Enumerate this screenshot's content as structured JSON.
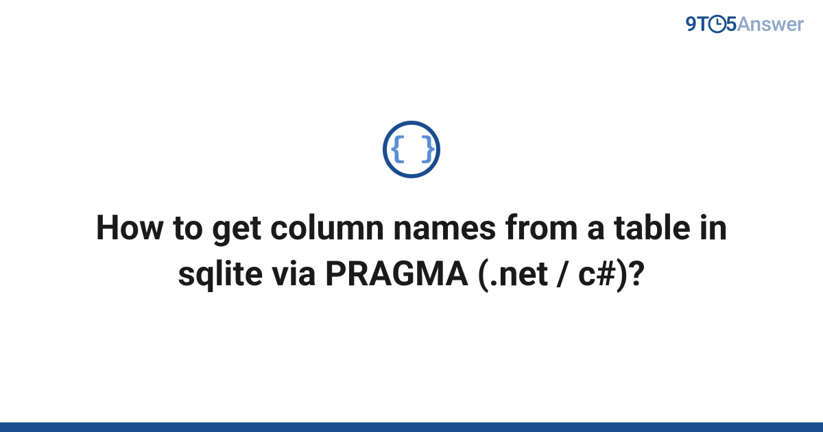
{
  "logo": {
    "part1": "9T",
    "part2": "5",
    "part3": "Answer"
  },
  "badge": {
    "symbol": "{ }"
  },
  "title": "How to get column names from a table in sqlite via PRAGMA (.net / c#)?",
  "colors": {
    "brand_dark": "#1a4d8f",
    "brand_light": "#8fa8c8",
    "accent": "#5a8fd4"
  }
}
